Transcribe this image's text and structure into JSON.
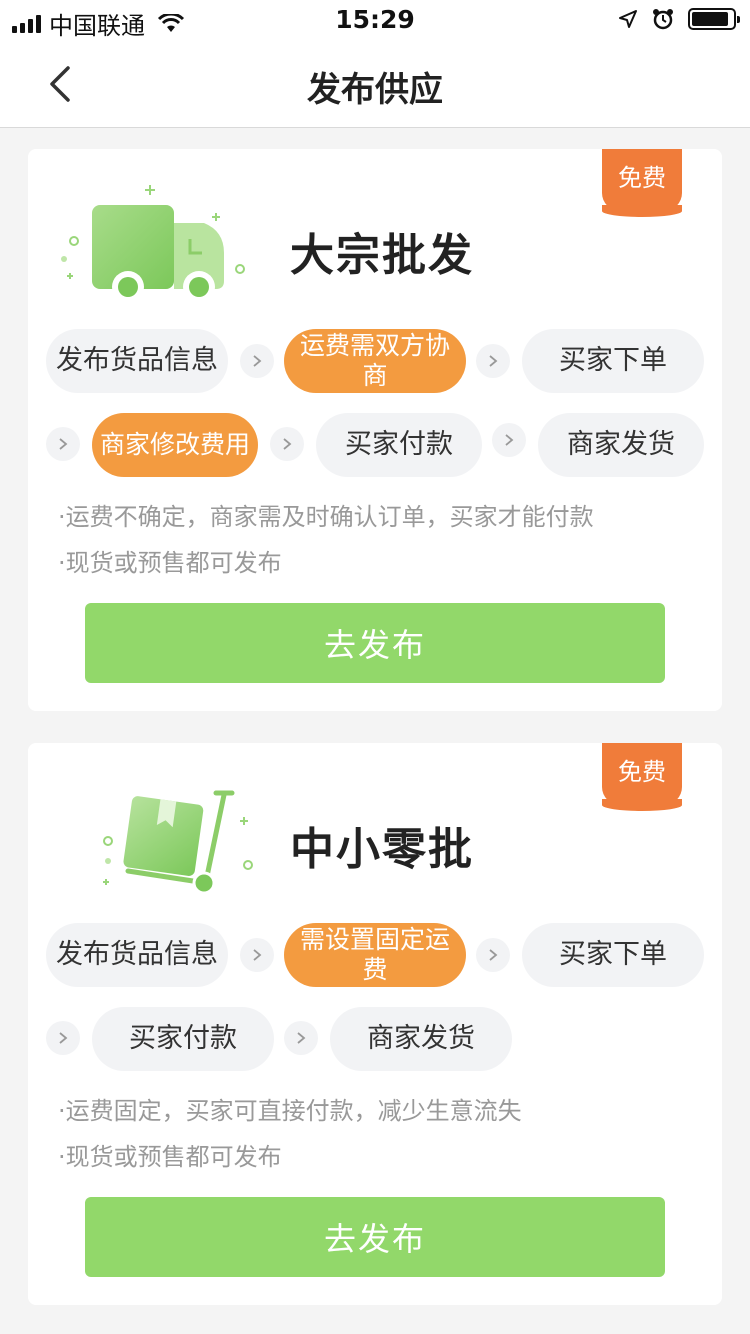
{
  "status_bar": {
    "carrier": "中国联通",
    "time": "15:29"
  },
  "nav": {
    "title": "发布供应"
  },
  "cards": [
    {
      "badge": "免费",
      "title": "大宗批发",
      "illustration": "truck-icon",
      "steps_row1": [
        "发布货品信息",
        "运费需双方协商",
        "买家下单"
      ],
      "steps_row2": [
        "商家修改费用",
        "买家付款",
        "商家发货"
      ],
      "notes": [
        "·运费不确定，商家需及时确认订单，买家才能付款",
        "·现货或预售都可发布"
      ],
      "button": "去发布"
    },
    {
      "badge": "免费",
      "title": "中小零批",
      "illustration": "hand-truck-icon",
      "steps_row1": [
        "发布货品信息",
        "需设置固定运费",
        "买家下单"
      ],
      "steps_row2": [
        "买家付款",
        "商家发货"
      ],
      "notes": [
        "·运费固定，买家可直接付款，减少生意流失",
        "·现货或预售都可发布"
      ],
      "button": "去发布"
    }
  ],
  "colors": {
    "badge": "#f07c3a",
    "highlight_step": "#f39b40",
    "button": "#92d86a"
  }
}
